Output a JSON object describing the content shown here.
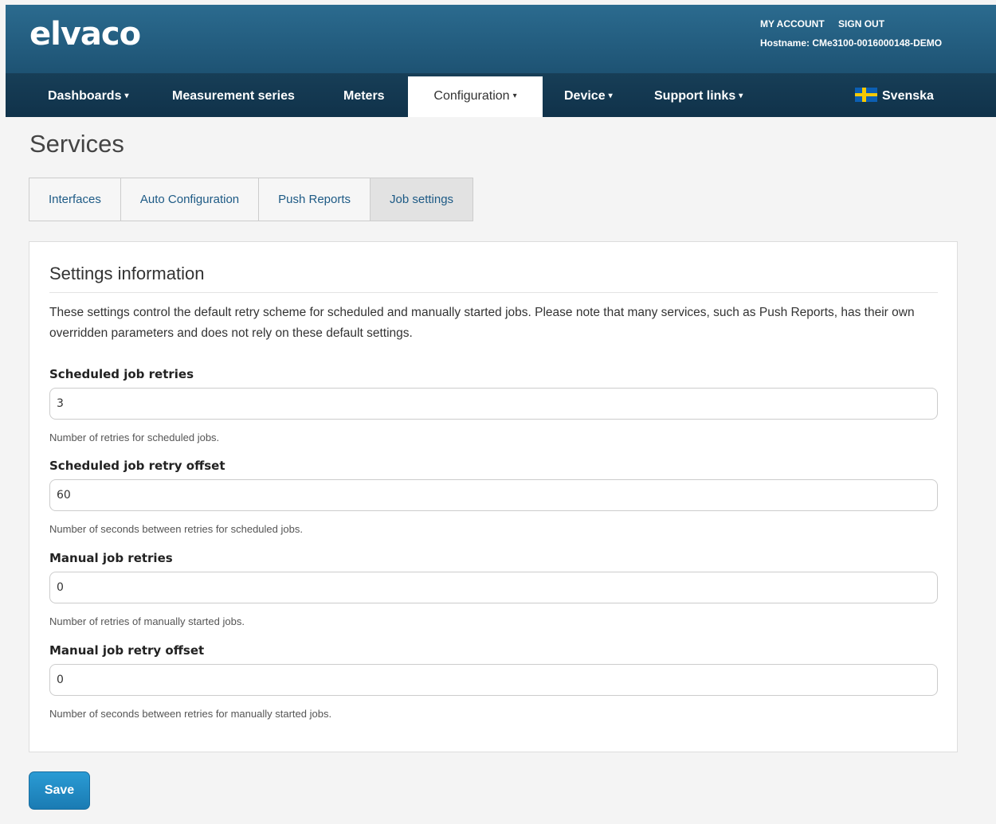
{
  "brand": {
    "logo": "elvaco"
  },
  "account": {
    "my_account": "MY ACCOUNT",
    "sign_out": "SIGN OUT",
    "hostname": "Hostname: CMe3100-0016000148-DEMO"
  },
  "nav": {
    "dashboards": "Dashboards",
    "measurement_series": "Measurement series",
    "meters": "Meters",
    "configuration": "Configuration",
    "device": "Device",
    "support_links": "Support links",
    "language": "Svenska",
    "caret": "▾"
  },
  "page": {
    "title": "Services"
  },
  "tabs": [
    "Interfaces",
    "Auto Configuration",
    "Push Reports",
    "Job settings"
  ],
  "panel": {
    "heading": "Settings information",
    "description": "These settings control the default retry scheme for scheduled and manually started jobs. Please note that many services, such as Push Reports, has their own overridden parameters and does not rely on these default settings."
  },
  "fields": [
    {
      "label": "Scheduled job retries",
      "value": "3",
      "help": "Number of retries for scheduled jobs."
    },
    {
      "label": "Scheduled job retry offset",
      "value": "60",
      "help": "Number of seconds between retries for scheduled jobs."
    },
    {
      "label": "Manual job retries",
      "value": "0",
      "help": "Number of retries of manually started jobs."
    },
    {
      "label": "Manual job retry offset",
      "value": "0",
      "help": "Number of seconds between retries for manually started jobs."
    }
  ],
  "actions": {
    "save": "Save"
  },
  "colors": {
    "header": "#1f5576",
    "navbar": "#10324a",
    "link": "#1d5a85",
    "save_button": "#2a9bd4"
  }
}
